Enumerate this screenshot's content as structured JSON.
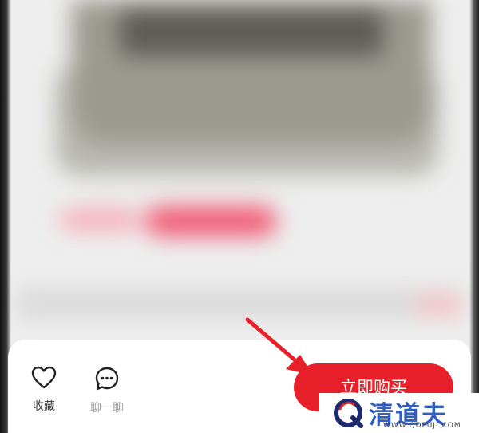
{
  "bottom_bar": {
    "favorite": {
      "label": "收藏",
      "icon": "heart-icon"
    },
    "chat": {
      "label": "聊一聊",
      "icon": "chat-bubble-icon"
    },
    "buy_now": {
      "label": "立即购买"
    }
  },
  "watermark": {
    "brand": "清道夫",
    "url": "WWW.QDFUJI.COM"
  },
  "colors": {
    "buy_button": "#e8202a",
    "arrow": "#e8202a",
    "watermark_blue": "#2f5fc4"
  }
}
